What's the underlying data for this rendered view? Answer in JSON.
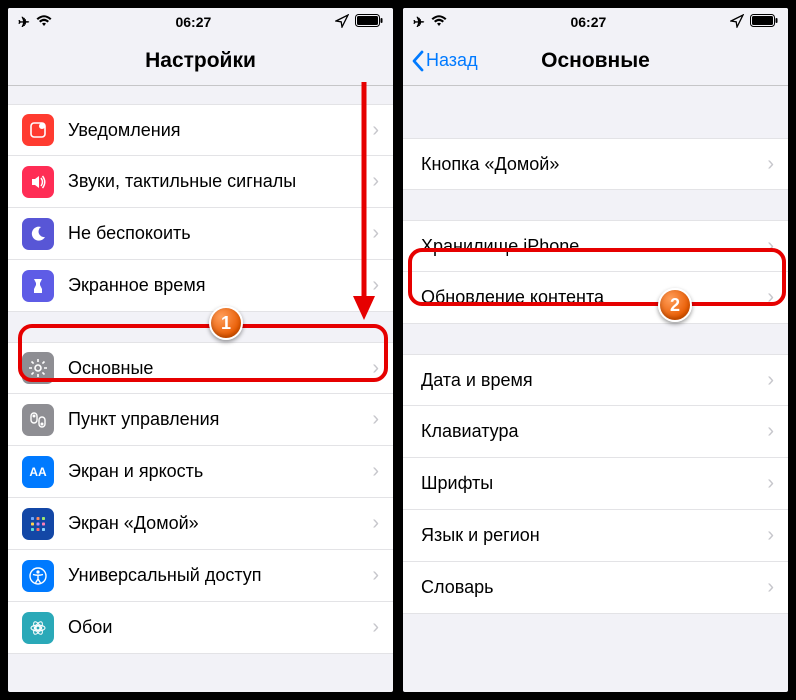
{
  "statusbar": {
    "time": "06:27"
  },
  "left": {
    "title": "Настройки",
    "group1": [
      {
        "name": "notifications",
        "label": "Уведомления"
      },
      {
        "name": "sounds",
        "label": "Звуки, тактильные сигналы"
      },
      {
        "name": "dnd",
        "label": "Не беспокоить"
      },
      {
        "name": "screentime",
        "label": "Экранное время"
      }
    ],
    "group2": [
      {
        "name": "general",
        "label": "Основные"
      },
      {
        "name": "controlcenter",
        "label": "Пункт управления"
      },
      {
        "name": "display",
        "label": "Экран и яркость"
      },
      {
        "name": "homescreen",
        "label": "Экран «Домой»"
      },
      {
        "name": "accessibility",
        "label": "Универсальный доступ"
      },
      {
        "name": "wallpaper",
        "label": "Обои"
      }
    ]
  },
  "right": {
    "back": "Назад",
    "title": "Основные",
    "group1": [
      {
        "name": "homebutton",
        "label": "Кнопка «Домой»"
      }
    ],
    "group2": [
      {
        "name": "storage",
        "label": "Хранилище iPhone"
      },
      {
        "name": "backgroundrefresh",
        "label": "Обновление контента"
      }
    ],
    "group3": [
      {
        "name": "datetime",
        "label": "Дата и время"
      },
      {
        "name": "keyboard",
        "label": "Клавиатура"
      },
      {
        "name": "fonts",
        "label": "Шрифты"
      },
      {
        "name": "language",
        "label": "Язык и регион"
      },
      {
        "name": "dictionary",
        "label": "Словарь"
      }
    ]
  },
  "badges": {
    "one": "1",
    "two": "2"
  }
}
